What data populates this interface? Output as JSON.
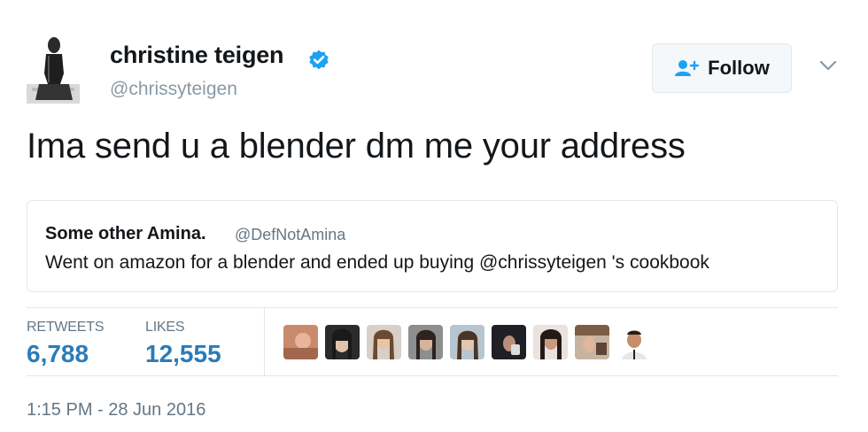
{
  "header": {
    "display_name": "christine teigen",
    "handle": "@chrissyteigen",
    "follow_label": "Follow",
    "verified": true
  },
  "tweet": {
    "text": "Ima send u a blender dm me your address"
  },
  "quoted_tweet": {
    "name": "Some other Amina.",
    "handle": "@DefNotAmina",
    "text": "Went on amazon for a blender and ended up buying @chrissyteigen 's cookbook"
  },
  "stats": {
    "retweets_label": "RETWEETS",
    "retweets_value": "6,788",
    "likes_label": "LIKES",
    "likes_value": "12,555"
  },
  "likers": [
    {
      "name": "liker-1"
    },
    {
      "name": "liker-2"
    },
    {
      "name": "liker-3"
    },
    {
      "name": "liker-4"
    },
    {
      "name": "liker-5"
    },
    {
      "name": "liker-6"
    },
    {
      "name": "liker-7"
    },
    {
      "name": "liker-8"
    },
    {
      "name": "liker-9"
    }
  ],
  "timestamp": "1:15 PM - 28 Jun 2016",
  "colors": {
    "link_blue": "#2b7bb9",
    "verified_blue": "#1da1f2",
    "muted_gray": "#657786",
    "border": "#e1e8ed"
  }
}
